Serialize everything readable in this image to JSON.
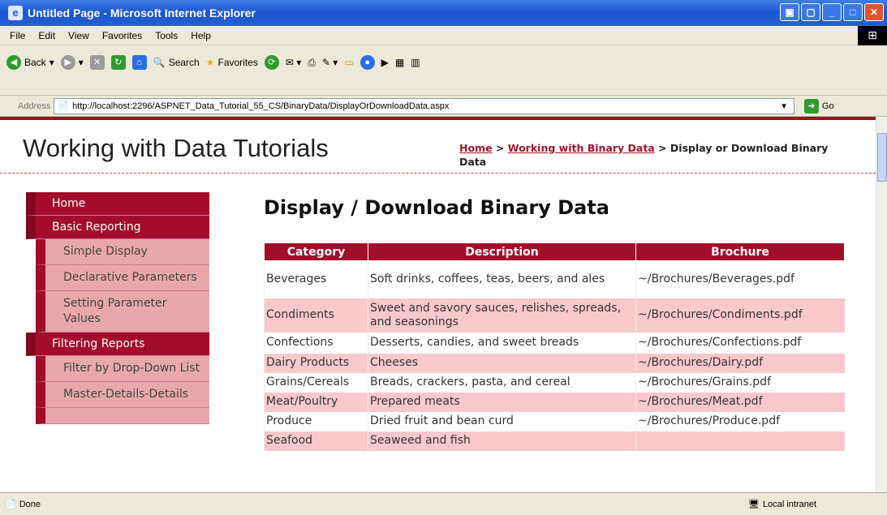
{
  "window": {
    "title": "Untitled Page - Microsoft Internet Explorer"
  },
  "menu": [
    "File",
    "Edit",
    "View",
    "Favorites",
    "Tools",
    "Help"
  ],
  "toolbar": {
    "back": "Back",
    "search": "Search",
    "favorites": "Favorites"
  },
  "address": {
    "label": "Address",
    "url": "http://localhost:2296/ASPNET_Data_Tutorial_55_CS/BinaryData/DisplayOrDownloadData.aspx",
    "go": "Go"
  },
  "site": {
    "title": "Working with Data Tutorials"
  },
  "breadcrumb": {
    "home": "Home",
    "sep": " > ",
    "parent": "Working with Binary Data",
    "current": "Display or Download Binary Data"
  },
  "sidebar": {
    "home": "Home",
    "basic": "Basic Reporting",
    "basic_items": [
      "Simple Display",
      "Declarative Parameters",
      "Setting Parameter Values"
    ],
    "filtering": "Filtering Reports",
    "filtering_items": [
      "Filter by Drop-Down List",
      "Master-Details-Details"
    ]
  },
  "page": {
    "heading": "Display / Download Binary Data"
  },
  "table": {
    "headers": [
      "Category",
      "Description",
      "Brochure"
    ],
    "rows": [
      [
        "Beverages",
        "Soft drinks, coffees, teas, beers, and ales",
        "~/Brochures/Beverages.pdf"
      ],
      [
        "Condiments",
        "Sweet and savory sauces, relishes, spreads, and seasonings",
        "~/Brochures/Condiments.pdf"
      ],
      [
        "Confections",
        "Desserts, candies, and sweet breads",
        "~/Brochures/Confections.pdf"
      ],
      [
        "Dairy Products",
        "Cheeses",
        "~/Brochures/Dairy.pdf"
      ],
      [
        "Grains/Cereals",
        "Breads, crackers, pasta, and cereal",
        "~/Brochures/Grains.pdf"
      ],
      [
        "Meat/Poultry",
        "Prepared meats",
        "~/Brochures/Meat.pdf"
      ],
      [
        "Produce",
        "Dried fruit and bean curd",
        "~/Brochures/Produce.pdf"
      ],
      [
        "Seafood",
        "Seaweed and fish",
        ""
      ]
    ]
  },
  "status": {
    "left": "Done",
    "zone": "Local intranet"
  }
}
